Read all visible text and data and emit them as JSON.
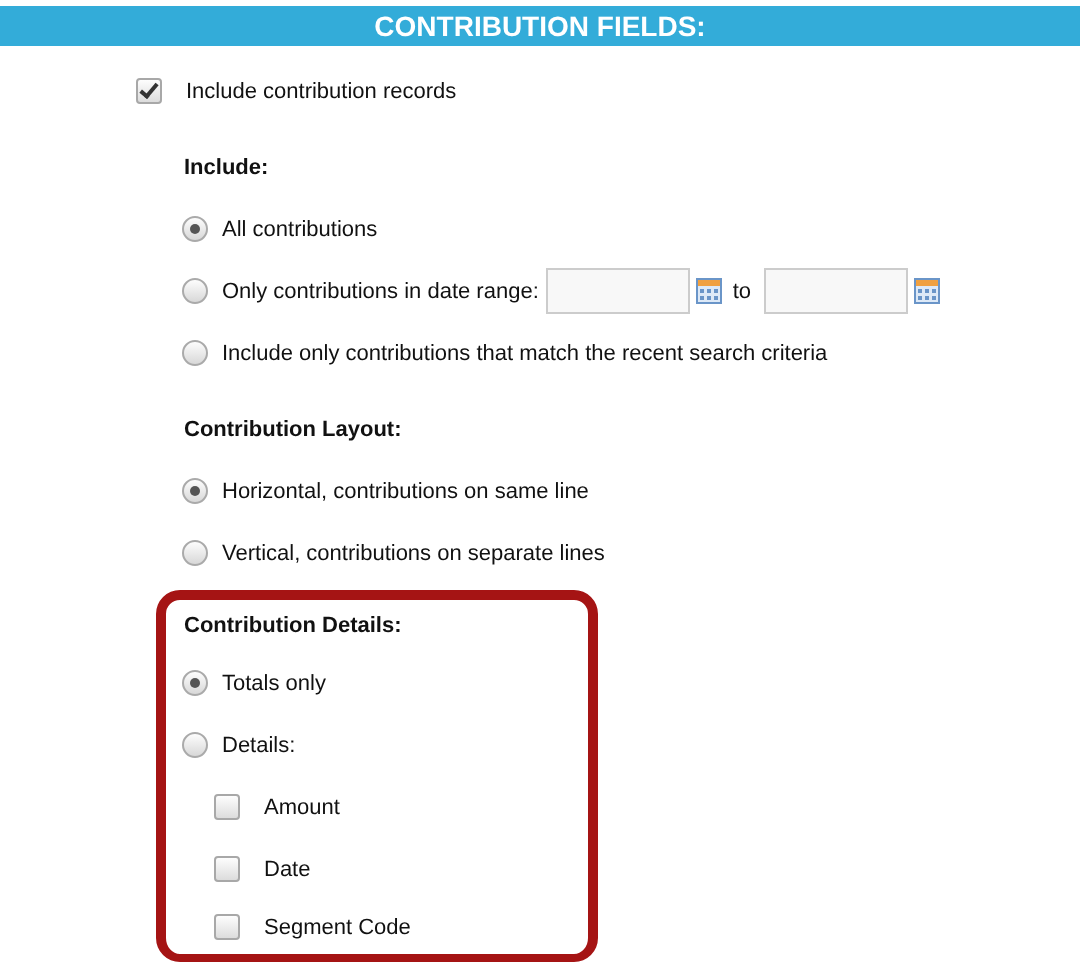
{
  "header": {
    "title": "CONTRIBUTION FIELDS:"
  },
  "include_records": {
    "label": "Include contribution records",
    "checked": true
  },
  "sections": [
    {
      "heading": "Include:",
      "highlighted": false,
      "options": [
        {
          "kind": "radio",
          "label": "All contributions",
          "selected": true
        },
        {
          "kind": "date-range",
          "label": "Only contributions in date range:",
          "selected": false,
          "to_label": "to"
        },
        {
          "kind": "radio",
          "label": "Include only contributions that match the recent search criteria",
          "selected": false
        }
      ]
    },
    {
      "heading": "Contribution Layout:",
      "highlighted": false,
      "options": [
        {
          "kind": "radio",
          "label": "Horizontal, contributions on same line",
          "selected": true
        },
        {
          "kind": "radio",
          "label": "Vertical, contributions on separate lines",
          "selected": false
        }
      ]
    },
    {
      "heading": "Contribution Details:",
      "highlighted": true,
      "options": [
        {
          "kind": "radio",
          "label": "Totals only",
          "selected": true
        },
        {
          "kind": "radio",
          "label": "Details:",
          "selected": false,
          "children": [
            {
              "label": "Amount",
              "checked": false
            },
            {
              "label": "Date",
              "checked": false
            },
            {
              "label": "Segment Code",
              "checked": false
            }
          ]
        }
      ]
    }
  ]
}
